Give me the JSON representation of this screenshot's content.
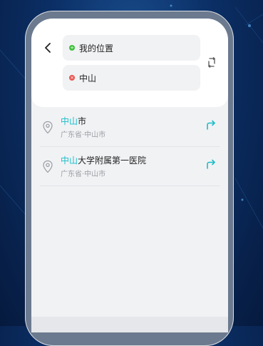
{
  "route": {
    "start": {
      "label": "我的位置",
      "color": "#3cc13b"
    },
    "end": {
      "label": "中山",
      "color": "#e9534d"
    }
  },
  "results": [
    {
      "highlight": "中山",
      "rest": "市",
      "address": "广东省·中山市"
    },
    {
      "highlight": "中山",
      "rest": "大学附属第一医院",
      "address": "广东省·中山市"
    }
  ],
  "colors": {
    "accent": "#19bdc9",
    "background": "#0b2f66",
    "frame": "#6c7a8f"
  }
}
